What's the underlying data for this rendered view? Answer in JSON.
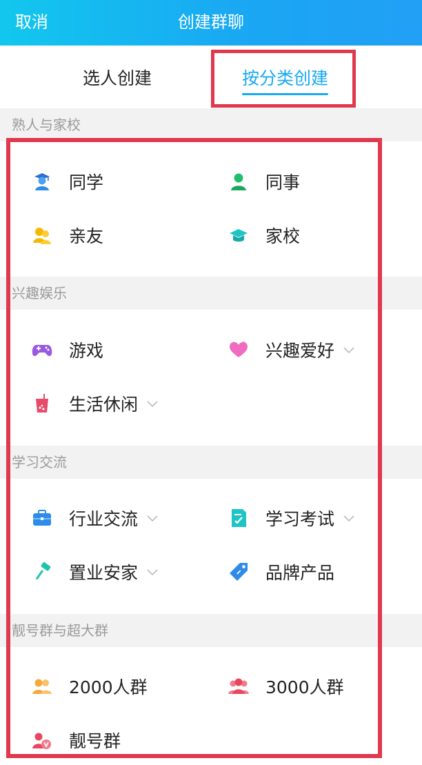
{
  "header": {
    "cancel": "取消",
    "title": "创建群聊"
  },
  "tabs": [
    {
      "label": "选人创建",
      "active": false
    },
    {
      "label": "按分类创建",
      "active": true
    }
  ],
  "colors": {
    "header_start": "#12c7ee",
    "header_end": "#22a0f5",
    "accent": "#19a8f3",
    "highlight": "#e0384d"
  },
  "sections": [
    {
      "title": "熟人与家校",
      "items": [
        {
          "label": "同学",
          "icon": "graduate-student-icon",
          "has_chevron": false
        },
        {
          "label": "同事",
          "icon": "colleague-person-icon",
          "has_chevron": false
        },
        {
          "label": "亲友",
          "icon": "friends-icon",
          "has_chevron": false
        },
        {
          "label": "家校",
          "icon": "mortarboard-icon",
          "has_chevron": false
        }
      ]
    },
    {
      "title": "兴趣娱乐",
      "items": [
        {
          "label": "游戏",
          "icon": "gamepad-icon",
          "has_chevron": false
        },
        {
          "label": "兴趣爱好",
          "icon": "heart-icon",
          "has_chevron": true
        },
        {
          "label": "生活休闲",
          "icon": "drink-cup-icon",
          "has_chevron": true
        }
      ]
    },
    {
      "title": "学习交流",
      "items": [
        {
          "label": "行业交流",
          "icon": "briefcase-icon",
          "has_chevron": true
        },
        {
          "label": "学习考试",
          "icon": "exam-paper-icon",
          "has_chevron": true
        },
        {
          "label": "置业安家",
          "icon": "paint-roller-icon",
          "has_chevron": true
        },
        {
          "label": "品牌产品",
          "icon": "price-tag-icon",
          "has_chevron": false
        }
      ]
    },
    {
      "title": "靓号群与超大群",
      "items": [
        {
          "label": "2000人群",
          "icon": "group-2000-icon",
          "has_chevron": false
        },
        {
          "label": "3000人群",
          "icon": "group-3000-icon",
          "has_chevron": false
        },
        {
          "label": "靓号群",
          "icon": "pretty-number-group-icon",
          "has_chevron": false
        }
      ]
    }
  ]
}
